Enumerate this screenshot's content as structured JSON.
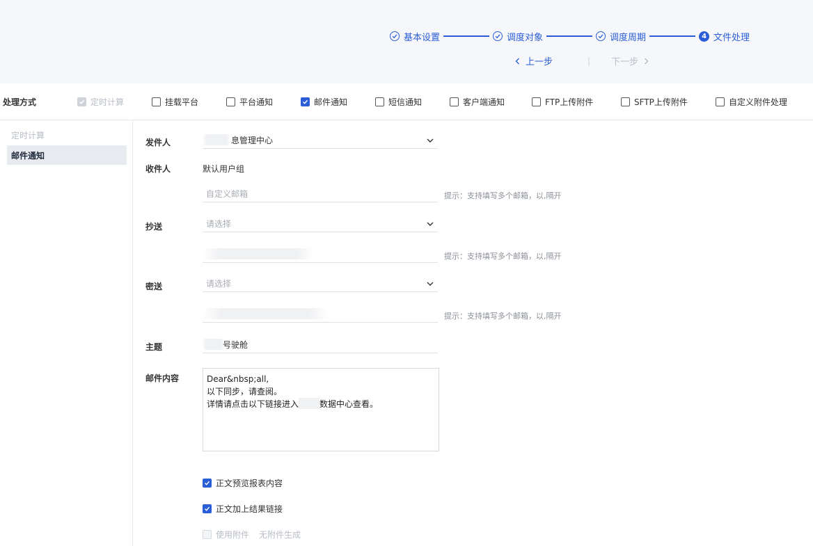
{
  "steps": [
    {
      "label": "基本设置",
      "state": "done"
    },
    {
      "label": "调度对象",
      "state": "done"
    },
    {
      "label": "调度周期",
      "state": "done"
    },
    {
      "label": "文件处理",
      "state": "current",
      "number": "4"
    }
  ],
  "nav": {
    "prev": "上一步",
    "next": "下一步"
  },
  "mode": {
    "label": "处理方式",
    "options": [
      {
        "label": "定时计算",
        "checked": true,
        "disabled": true
      },
      {
        "label": "挂载平台",
        "checked": false
      },
      {
        "label": "平台通知",
        "checked": false
      },
      {
        "label": "邮件通知",
        "checked": true
      },
      {
        "label": "短信通知",
        "checked": false
      },
      {
        "label": "客户端通知",
        "checked": false
      },
      {
        "label": "FTP上传附件",
        "checked": false
      },
      {
        "label": "SFTP上传附件",
        "checked": false
      },
      {
        "label": "自定义附件处理",
        "checked": false
      }
    ]
  },
  "sidebar": {
    "items": [
      {
        "label": "定时计算",
        "state": "disabled"
      },
      {
        "label": "邮件通知",
        "state": "active"
      }
    ]
  },
  "form": {
    "sender_label": "发件人",
    "sender_value": "息管理中心",
    "recipient_label": "收件人",
    "recipient_value": "默认用户组",
    "custom_email_placeholder": "自定义邮箱",
    "hint": "提示：支持填写多个邮箱，以,隔开",
    "cc_label": "抄送",
    "select_placeholder": "请选择",
    "bcc_label": "密送",
    "subject_label": "主题",
    "subject_value": "号驶舱",
    "content_label": "邮件内容",
    "content_lines": [
      "Dear&nbsp;all,",
      "以下同步，请查阅。",
      "详情请点击以下链接进入",
      "数据中心查看。"
    ]
  },
  "options": {
    "preview": {
      "label": "正文预览报表内容",
      "checked": true
    },
    "link": {
      "label": "正文加上结果链接",
      "checked": true
    },
    "attachment": {
      "label": "使用附件",
      "extra": "无附件生成",
      "checked": false,
      "disabled": true
    }
  },
  "colors": {
    "accent": "#2b5ed6",
    "header_bg": "#f5f7fb",
    "muted": "#b8bdc6"
  }
}
